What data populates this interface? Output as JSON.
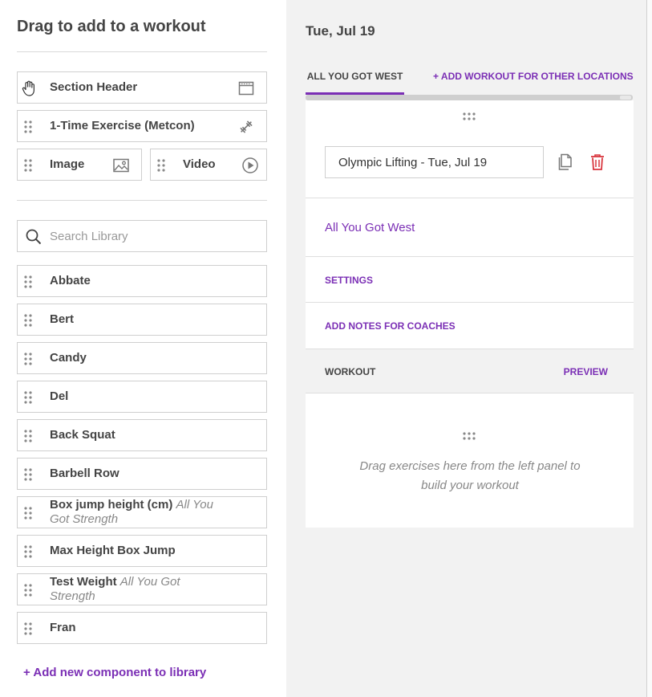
{
  "left_panel": {
    "title": "Drag to add to a workout",
    "components": [
      {
        "label": "Section Header",
        "icon": "section-header-icon"
      },
      {
        "label": "1-Time Exercise (Metcon)",
        "icon": "dumbbell-icon"
      },
      {
        "label": "Image",
        "icon": "image-icon"
      },
      {
        "label": "Video",
        "icon": "play-icon"
      }
    ],
    "search": {
      "placeholder": "Search Library",
      "value": ""
    },
    "library": [
      {
        "label": "Abbate",
        "note": ""
      },
      {
        "label": "Bert",
        "note": ""
      },
      {
        "label": "Candy",
        "note": ""
      },
      {
        "label": "Del",
        "note": ""
      },
      {
        "label": "Back Squat",
        "note": ""
      },
      {
        "label": "Barbell Row",
        "note": ""
      },
      {
        "label": "Box jump height (cm)",
        "note": "All You Got Strength"
      },
      {
        "label": "Max Height Box Jump",
        "note": ""
      },
      {
        "label": "Test Weight",
        "note": "All You Got Strength"
      },
      {
        "label": "Fran",
        "note": ""
      }
    ],
    "add_link": "+ Add new component to library"
  },
  "right_panel": {
    "date": "Tue, Jul 19",
    "tabs": {
      "active": "ALL YOU GOT WEST",
      "add": "+ ADD WORKOUT FOR OTHER LOCATIONS"
    },
    "workout_name": "Olympic Lifting - Tue, Jul 19",
    "location_link": "All You Got West",
    "settings_link": "SETTINGS",
    "notes_link": "ADD NOTES FOR COACHES",
    "workout_label": "WORKOUT",
    "preview_link": "PREVIEW",
    "drop_hint": "Drag exercises here from the left panel to build your workout"
  },
  "colors": {
    "accent": "#7b2fb5",
    "danger": "#d9363e",
    "panel_bg": "#f2f2f2"
  }
}
